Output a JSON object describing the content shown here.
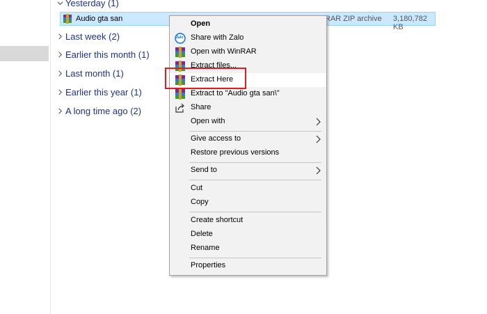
{
  "groups": [
    {
      "label": "Yesterday (1)"
    },
    {
      "label": "Last week (2)"
    },
    {
      "label": "Earlier this month (1)"
    },
    {
      "label": "Last month (1)"
    },
    {
      "label": "Earlier this year (1)"
    },
    {
      "label": "A long time ago (2)"
    }
  ],
  "file": {
    "name": "Audio gta san",
    "type": "RAR ZIP archive",
    "size": "3,180,782 KB"
  },
  "context_menu": {
    "open": "Open",
    "share_zalo": "Share with Zalo",
    "open_winrar": "Open with WinRAR",
    "extract_files": "Extract files...",
    "extract_here": "Extract Here",
    "extract_to": "Extract to \"Audio gta san\\\"",
    "share": "Share",
    "open_with": "Open with",
    "give_access": "Give access to",
    "restore": "Restore previous versions",
    "send_to": "Send to",
    "cut": "Cut",
    "copy": "Copy",
    "create_shortcut": "Create shortcut",
    "delete": "Delete",
    "rename": "Rename",
    "properties": "Properties"
  },
  "zalo_icon_text": "Zalo",
  "colors": {
    "group_header": "#1e3287",
    "selection": "#cce8ff",
    "highlight_box": "#e21b1b"
  }
}
